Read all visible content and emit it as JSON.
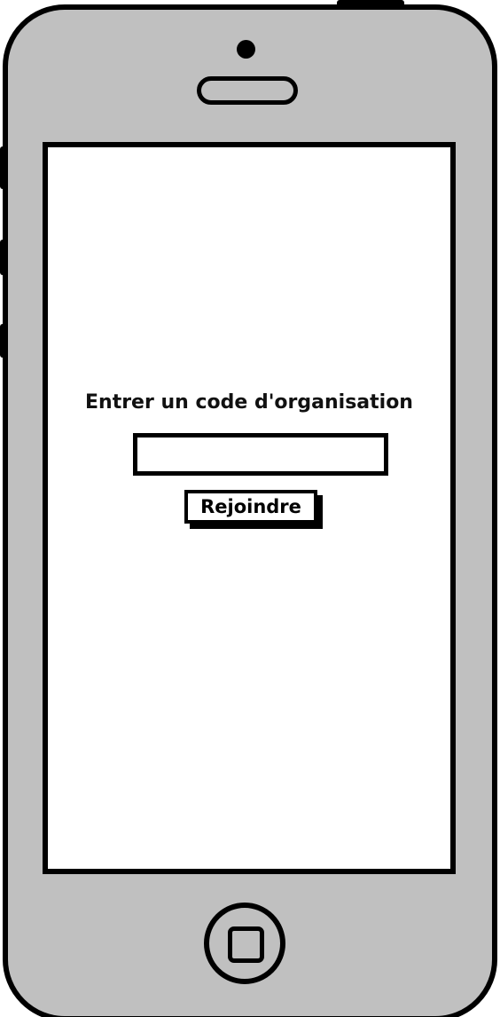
{
  "screen": {
    "title": "Entrer un code d'organisation",
    "code_input": {
      "value": "",
      "placeholder": ""
    },
    "join_button_label": "Rejoindre"
  },
  "colors": {
    "phone_body": "#c0c0c0",
    "outline": "#000000",
    "screen_bg": "#ffffff"
  },
  "icons": {
    "home_button": "home-button-icon",
    "camera": "camera-icon",
    "speaker": "speaker-icon"
  }
}
